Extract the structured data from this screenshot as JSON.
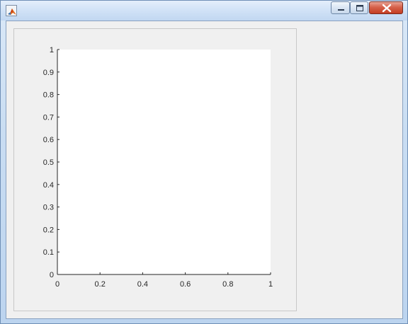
{
  "window": {
    "icon": "matlab-icon",
    "controls": {
      "minimize": "minimize-icon",
      "maximize": "maximize-icon",
      "close": "close-icon"
    }
  },
  "chart_data": {
    "type": "line",
    "series": [],
    "xlim": [
      0,
      1
    ],
    "ylim": [
      0,
      1
    ],
    "xticks": [
      "0",
      "0.2",
      "0.4",
      "0.6",
      "0.8",
      "1"
    ],
    "yticks": [
      "0",
      "0.1",
      "0.2",
      "0.3",
      "0.4",
      "0.5",
      "0.6",
      "0.7",
      "0.8",
      "0.9",
      "1"
    ],
    "grid": false,
    "colors": {
      "axes_bg": "#ffffff",
      "figure_bg": "#f0f0f0",
      "axis_line": "#262626"
    }
  }
}
